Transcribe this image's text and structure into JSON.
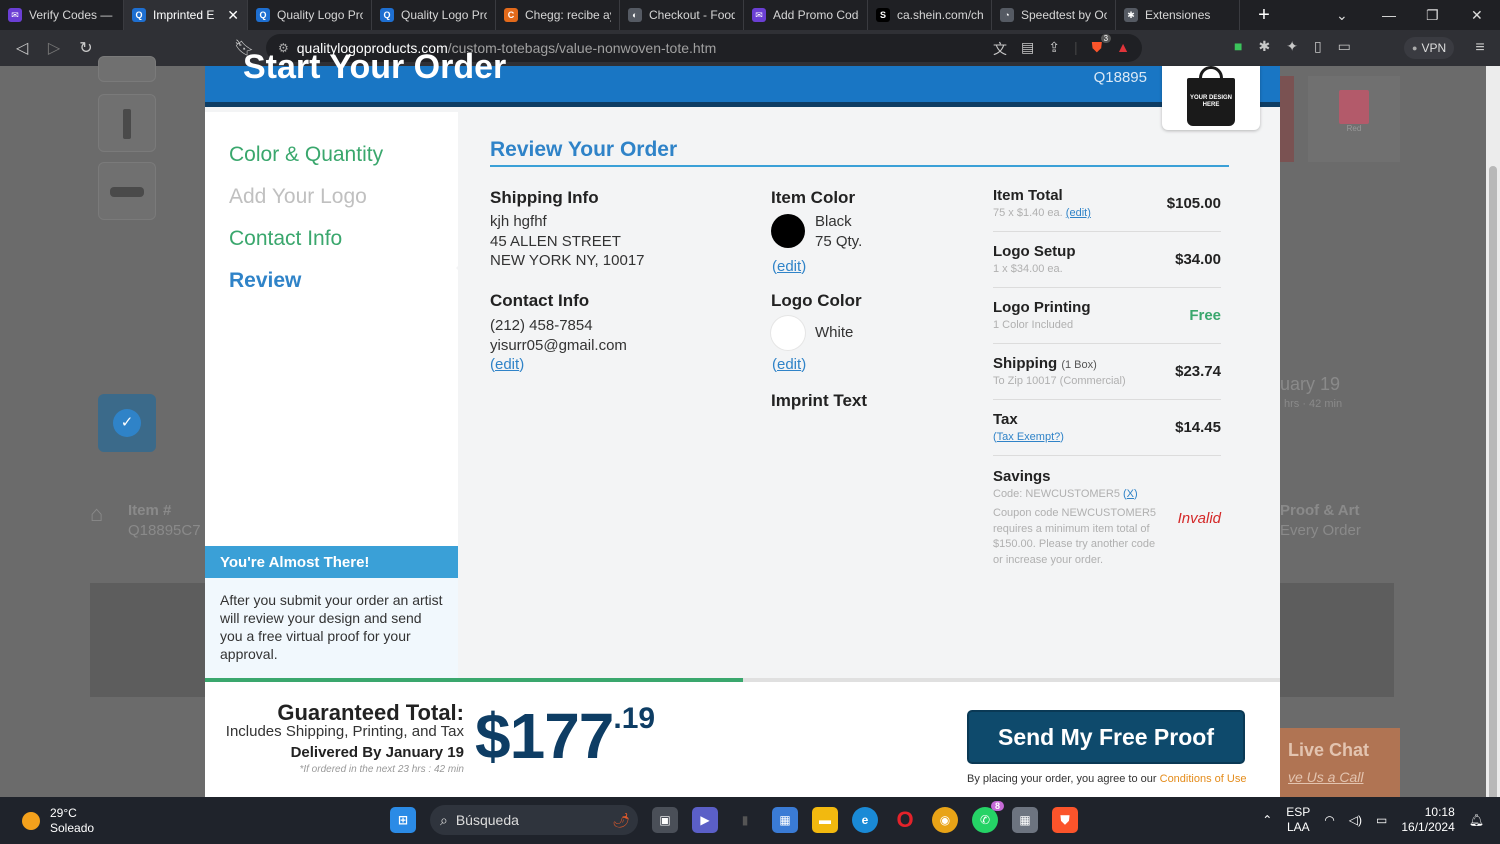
{
  "browser": {
    "tabs": [
      {
        "title": "Verify Codes — S",
        "color": "#6b3fd4",
        "glyph": "✉",
        "active": false
      },
      {
        "title": "Imprinted E",
        "color": "#1e6fd1",
        "glyph": "Q",
        "active": true
      },
      {
        "title": "Quality Logo Pro",
        "color": "#1e6fd1",
        "glyph": "Q",
        "active": false
      },
      {
        "title": "Quality Logo Pro",
        "color": "#1e6fd1",
        "glyph": "Q",
        "active": false
      },
      {
        "title": "Chegg: recibe ay",
        "color": "#e36a1b",
        "glyph": "C",
        "active": false
      },
      {
        "title": "Checkout - Food",
        "color": "#555a63",
        "glyph": "◐",
        "active": false
      },
      {
        "title": "Add Promo Code",
        "color": "#6b3fd4",
        "glyph": "✉",
        "active": false
      },
      {
        "title": "ca.shein.com/che",
        "color": "#000000",
        "glyph": "S",
        "active": false
      },
      {
        "title": "Speedtest by Oo",
        "color": "#555a63",
        "glyph": "◔",
        "active": false
      },
      {
        "title": "Extensiones",
        "color": "#555a63",
        "glyph": "✱",
        "active": false
      }
    ],
    "url_host": "qualitylogoproducts.com",
    "url_path": "/custom-totebags/value-nonwoven-tote.htm",
    "vpn_label": "VPN",
    "brave_badge": "3"
  },
  "background": {
    "item_label": "Item #",
    "item_value": "Q18895C7",
    "proof_label": "Proof & Art",
    "proof_sub": "Every Order",
    "date_label": "uary 19",
    "date_sub": "hrs · 42 min",
    "tote_tag": "Red",
    "live_chat": "Live Chat",
    "give_call": "ve Us a Call"
  },
  "modal": {
    "title": "Start Your Order",
    "item_code": "Q18895",
    "tote_text": "YOUR DESIGN HERE",
    "steps": [
      {
        "label": "Color & Quantity",
        "state": "done"
      },
      {
        "label": "Add Your Logo",
        "state": "disabled"
      },
      {
        "label": "Contact Info",
        "state": "done"
      },
      {
        "label": "Review",
        "state": "current"
      }
    ],
    "almost": {
      "title": "You're Almost There!",
      "body": "After you submit your order an artist will review your design and send you a free virtual proof for your approval."
    },
    "review_title": "Review Your Order",
    "shipping": {
      "heading": "Shipping Info",
      "name": "kjh hgfhf",
      "street": "45 ALLEN STREET",
      "city": "NEW YORK NY, 10017"
    },
    "contact": {
      "heading": "Contact Info",
      "phone": "(212) 458-7854",
      "email": "yisurr05@gmail.com",
      "edit": "edit"
    },
    "item_color": {
      "heading": "Item Color",
      "color_name": "Black",
      "swatch": "#000000",
      "qty": "75 Qty.",
      "edit": "edit"
    },
    "logo_color": {
      "heading": "Logo Color",
      "color_name": "White",
      "swatch": "#ffffff",
      "edit": "edit"
    },
    "imprint_heading": "Imprint Text",
    "summary": {
      "item_total": {
        "label": "Item Total",
        "sub": "75 x $1.40 ea.",
        "edit": "(edit)",
        "value": "$105.00"
      },
      "logo_setup": {
        "label": "Logo Setup",
        "sub": "1 x $34.00 ea.",
        "value": "$34.00"
      },
      "logo_printing": {
        "label": "Logo Printing",
        "sub": "1 Color Included",
        "value": "Free"
      },
      "shipping": {
        "label": "Shipping",
        "boxes": "(1 Box)",
        "sub": "To Zip 10017 (Commercial)",
        "value": "$23.74"
      },
      "tax": {
        "label": "Tax",
        "exempt": "Tax Exempt?",
        "value": "$14.45"
      },
      "savings": {
        "label": "Savings",
        "code": "Code: NEWCUSTOMER5",
        "remove": "X",
        "message": "Coupon code NEWCUSTOMER5 requires a minimum item total of $150.00. Please try another code or increase your order.",
        "value": "Invalid"
      }
    },
    "progress_percent": 50,
    "footer": {
      "gt_title": "Guaranteed Total:",
      "gt_includes": "Includes Shipping, Printing, and Tax",
      "delivered": "Delivered By January 19",
      "note": "*If ordered in the next 23 hrs : 42 min",
      "price_dollars": "$177",
      "price_cents": ".19",
      "send_button": "Send My Free Proof",
      "terms_text": "By placing your order, you agree to our",
      "terms_link": "Conditions of Use"
    }
  },
  "taskbar": {
    "temp": "29°C",
    "weather": "Soleado",
    "search": "Búsqueda",
    "whatsapp_badge": "8",
    "lang1": "ESP",
    "lang2": "LAA",
    "time": "10:18",
    "date": "16/1/2024"
  }
}
